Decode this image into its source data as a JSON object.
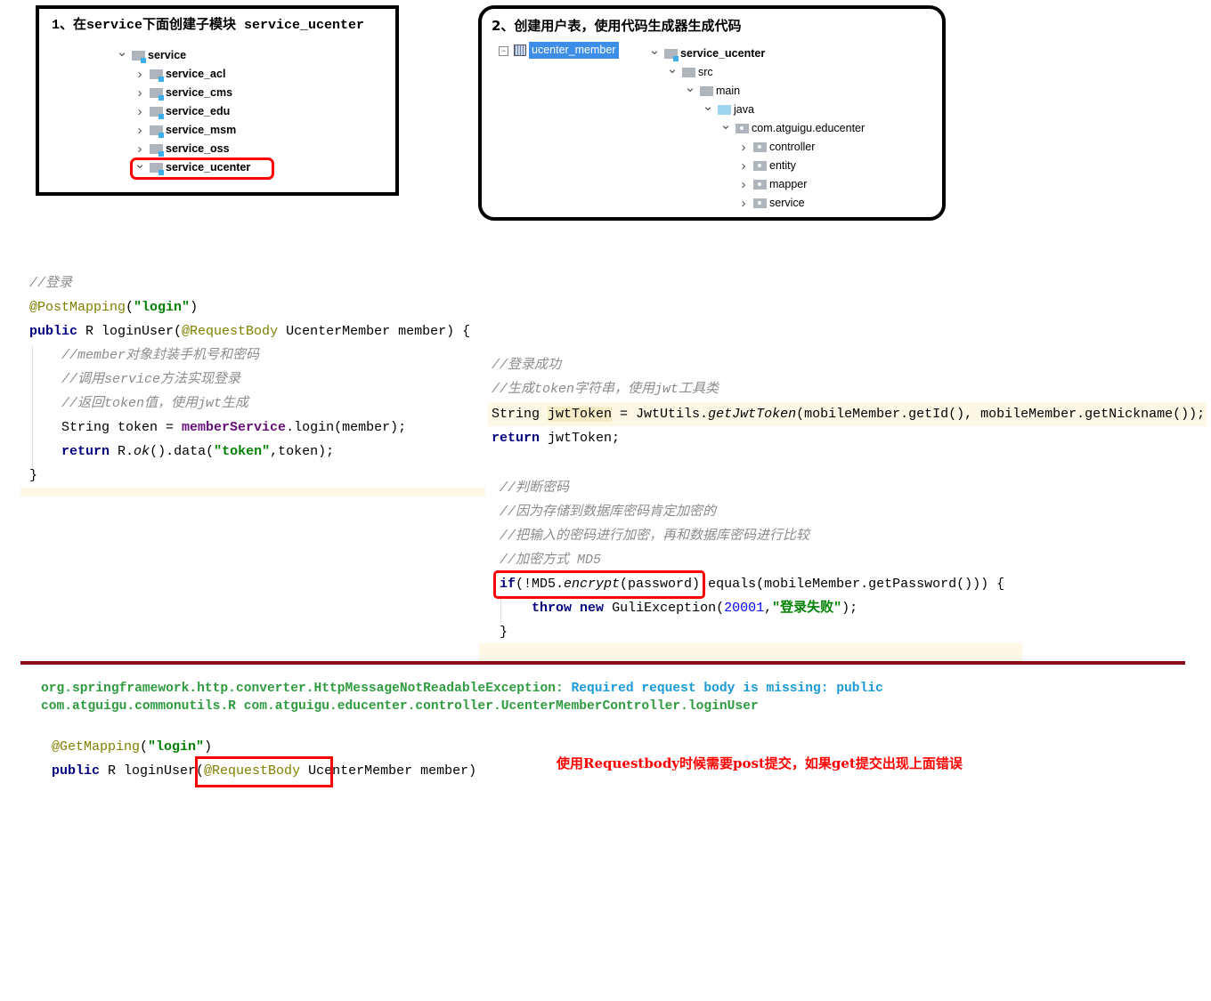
{
  "step1": {
    "title": "1、在service下面创建子模块 service_ucenter",
    "tree": [
      {
        "label": "service",
        "expanded": true,
        "level": 0
      },
      {
        "label": "service_acl",
        "expanded": false,
        "level": 1
      },
      {
        "label": "service_cms",
        "expanded": false,
        "level": 1
      },
      {
        "label": "service_edu",
        "expanded": false,
        "level": 1
      },
      {
        "label": "service_msm",
        "expanded": false,
        "level": 1
      },
      {
        "label": "service_oss",
        "expanded": false,
        "level": 1
      },
      {
        "label": "service_ucenter",
        "expanded": true,
        "level": 1,
        "highlighted": true
      }
    ]
  },
  "step2": {
    "title": "2、创建用户表，使用代码生成器生成代码",
    "db_table": "ucenter_member",
    "tree": [
      {
        "label": "service_ucenter",
        "expanded": true,
        "kind": "module"
      },
      {
        "label": "src",
        "expanded": true,
        "kind": "folder"
      },
      {
        "label": "main",
        "expanded": true,
        "kind": "folder"
      },
      {
        "label": "java",
        "expanded": true,
        "kind": "source"
      },
      {
        "label": "com.atguigu.educenter",
        "expanded": true,
        "kind": "package"
      },
      {
        "label": "controller",
        "expanded": false,
        "kind": "package"
      },
      {
        "label": "entity",
        "expanded": false,
        "kind": "package"
      },
      {
        "label": "mapper",
        "expanded": false,
        "kind": "package"
      },
      {
        "label": "service",
        "expanded": false,
        "kind": "package"
      }
    ]
  },
  "code_login": [
    [
      [
        "//登录",
        "comment"
      ]
    ],
    [
      [
        "@PostMapping",
        "annotation"
      ],
      [
        "(",
        "plain"
      ],
      [
        "\"login\"",
        "string"
      ],
      [
        ")",
        "plain"
      ]
    ],
    [
      [
        "public",
        "keyword"
      ],
      [
        " R loginUser(",
        "plain"
      ],
      [
        "@RequestBody",
        "annotation"
      ],
      [
        " UcenterMember member) {",
        "plain"
      ]
    ],
    [
      [
        "    ",
        "plain"
      ],
      [
        "//member对象封装手机号和密码",
        "comment"
      ]
    ],
    [
      [
        "    ",
        "plain"
      ],
      [
        "//调用service方法实现登录",
        "comment"
      ]
    ],
    [
      [
        "    ",
        "plain"
      ],
      [
        "//返回token值，使用jwt生成",
        "comment"
      ]
    ],
    [
      [
        "    String token = ",
        "plain"
      ],
      [
        "memberService",
        "field"
      ],
      [
        ".login(member);",
        "plain"
      ]
    ],
    [
      [
        "    ",
        "plain"
      ],
      [
        "return",
        "keyword"
      ],
      [
        " R.",
        "plain"
      ],
      [
        "ok",
        "static"
      ],
      [
        "().data(",
        "plain"
      ],
      [
        "\"token\"",
        "string"
      ],
      [
        ",token);",
        "plain"
      ]
    ],
    [
      [
        "}",
        "plain"
      ]
    ]
  ],
  "code_token": [
    [
      [
        "//登录成功",
        "comment"
      ]
    ],
    [
      [
        "//生成token字符串，使用jwt工具类",
        "comment"
      ]
    ],
    [
      [
        "String ",
        "plain"
      ],
      [
        "jwtToken",
        "hl"
      ],
      [
        " = JwtUtils.",
        "plain"
      ],
      [
        "getJwtToken",
        "static"
      ],
      [
        "(mobileMember.getId(), mobileMember.getNickname());",
        "plain"
      ]
    ],
    [
      [
        "return",
        "keyword"
      ],
      [
        " jwtToken;",
        "plain"
      ]
    ]
  ],
  "code_password": [
    [
      [
        "//判断密码",
        "comment"
      ]
    ],
    [
      [
        "//因为存储到数据库密码肯定加密的",
        "comment"
      ]
    ],
    [
      [
        "//把输入的密码进行加密，再和数据库密码进行比较",
        "comment"
      ]
    ],
    [
      [
        "//加密方式 MD5",
        "comment"
      ]
    ],
    [
      [
        "if",
        "keyword"
      ],
      [
        "(!MD5.",
        "plain"
      ],
      [
        "encrypt",
        "static"
      ],
      [
        "(password).equals(mobileMember.getPassword())) {",
        "plain"
      ]
    ],
    [
      [
        "    ",
        "plain"
      ],
      [
        "throw",
        "keyword"
      ],
      [
        " ",
        "plain"
      ],
      [
        "new",
        "keyword"
      ],
      [
        " GuliException(",
        "plain"
      ],
      [
        "20001",
        "number"
      ],
      [
        ",",
        "plain"
      ],
      [
        "\"登录失败\"",
        "string"
      ],
      [
        ");",
        "plain"
      ]
    ],
    [
      [
        "}",
        "plain"
      ]
    ]
  ],
  "error": {
    "line1_class": "org.springframework.http.converter.HttpMessageNotReadableException: ",
    "line1_message": "Required request body is missing: public",
    "line2": "com.atguigu.commonutils.R com.atguigu.educenter.controller.UcenterMemberController.loginUser"
  },
  "code_get": [
    [
      [
        "@GetMapping",
        "annotation"
      ],
      [
        "(",
        "plain"
      ],
      [
        "\"login\"",
        "string"
      ],
      [
        ")",
        "plain"
      ]
    ],
    [
      [
        "public",
        "keyword"
      ],
      [
        " R loginUser(",
        "plain"
      ],
      [
        "@RequestBody",
        "annotation"
      ],
      [
        " UcenterMember member)",
        "plain"
      ]
    ]
  ],
  "note": "使用Requestbody时候需要post提交，如果get提交出现上面错误",
  "colors": {
    "highlight_box": "#ff0000",
    "divider": "#8b0a1a",
    "error_green": "#2e9b3f",
    "error_blue": "#1a9ad6",
    "selection": "#3d8ee8"
  }
}
